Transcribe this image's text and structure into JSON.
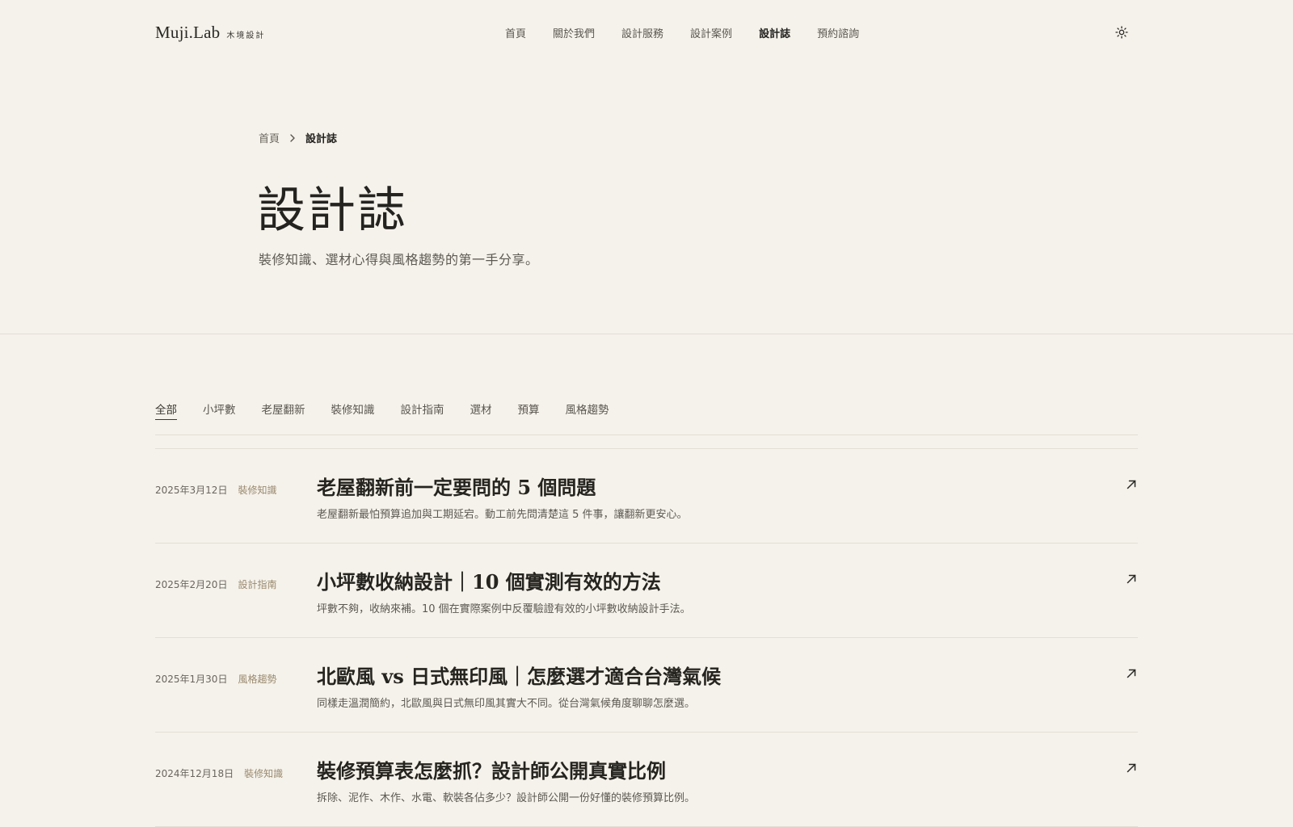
{
  "header": {
    "logo_main": "Muji.Lab",
    "logo_sub": "木境設計",
    "nav": [
      {
        "label": "首頁"
      },
      {
        "label": "關於我們"
      },
      {
        "label": "設計服務"
      },
      {
        "label": "設計案例"
      },
      {
        "label": "設計誌"
      },
      {
        "label": "預約諮詢"
      }
    ],
    "active_nav": "設計誌",
    "theme_icon": "sun-icon"
  },
  "breadcrumb": {
    "home": "首頁",
    "current": "設計誌"
  },
  "hero": {
    "title": "設計誌",
    "subtitle": "裝修知識、選材心得與風格趨勢的第一手分享。"
  },
  "filters": {
    "items": [
      "全部",
      "小坪數",
      "老屋翻新",
      "裝修知識",
      "設計指南",
      "選材",
      "預算",
      "風格趨勢"
    ],
    "active": "全部"
  },
  "articles": [
    {
      "date": "2025年3月12日",
      "tag": "裝修知識",
      "title": "老屋翻新前一定要問的 5 個問題",
      "excerpt": "老屋翻新最怕預算追加與工期延宕。動工前先問清楚這 5 件事，讓翻新更安心。"
    },
    {
      "date": "2025年2月20日",
      "tag": "設計指南",
      "title": "小坪數收納設計｜10 個實測有效的方法",
      "excerpt": "坪數不夠，收納來補。10 個在實際案例中反覆驗證有效的小坪數收納設計手法。"
    },
    {
      "date": "2025年1月30日",
      "tag": "風格趨勢",
      "title": "北歐風 vs 日式無印風｜怎麼選才適合台灣氣候",
      "excerpt": "同樣走溫潤簡約，北歐風與日式無印風其實大不同。從台灣氣候角度聊聊怎麼選。"
    },
    {
      "date": "2024年12月18日",
      "tag": "裝修知識",
      "title": "裝修預算表怎麼抓？設計師公開真實比例",
      "excerpt": "拆除、泥作、木作、水電、軟裝各佔多少？設計師公開一份好懂的裝修預算比例。"
    }
  ],
  "colors": {
    "background": "#f5f2eb",
    "text": "#2f2d29",
    "muted": "#5c5852",
    "tag": "#9a8a70",
    "divider": "#e3dfd6"
  }
}
